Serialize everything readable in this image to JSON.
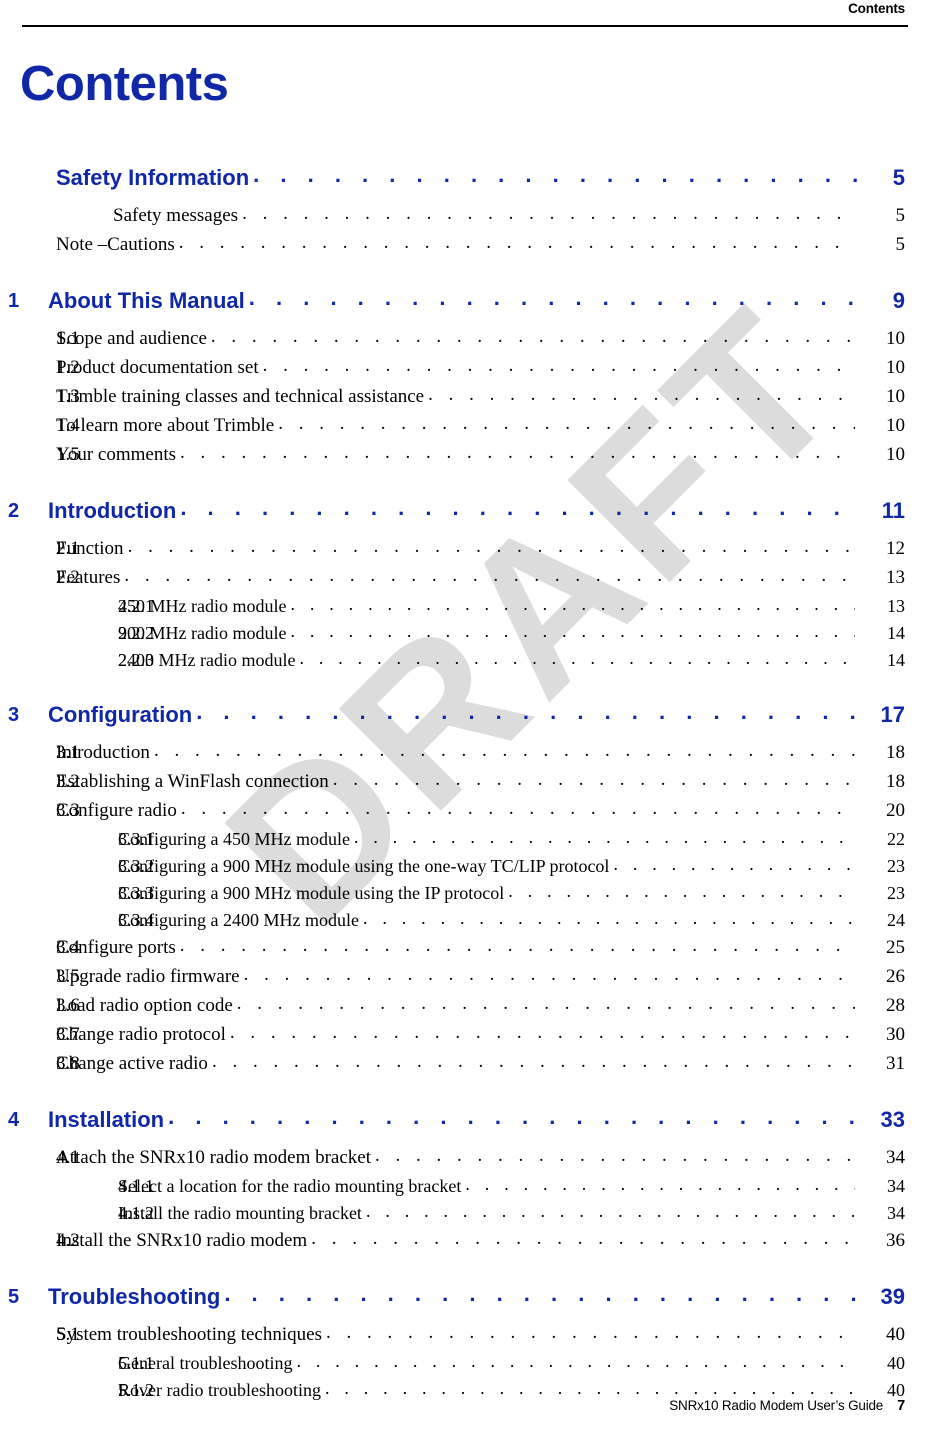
{
  "header": {
    "title": "Contents"
  },
  "page_title": "Contents",
  "watermark": {
    "text": "DRAFT",
    "color": "#dcdcdc"
  },
  "colors": {
    "heading_blue": "#1028A8",
    "body_black": "#000000"
  },
  "leader_dot": ". . . . . . . . . . . . . . . . . . . . . . . . . . . . . . . . . . . . . . . . . . . . . . . . . . . . . . . . . . . . . . . . . . . .",
  "toc": {
    "entries": [
      {
        "level": "chapter",
        "number": "",
        "label": "Safety Information",
        "page": "5"
      },
      {
        "level": "front-sub",
        "number": "",
        "label": "Safety messages",
        "page": "5"
      },
      {
        "level": "front",
        "number": "",
        "label": "Note –Cautions",
        "page": "5"
      },
      {
        "level": "chapter",
        "number": "1",
        "label": "About This Manual",
        "page": "9"
      },
      {
        "level": "section",
        "number": "1.1",
        "label": "Scope and audience",
        "page": "10"
      },
      {
        "level": "section",
        "number": "1.2",
        "label": "Product documentation set",
        "page": "10"
      },
      {
        "level": "section",
        "number": "1.3",
        "label": "Trimble training classes and technical assistance",
        "page": "10"
      },
      {
        "level": "section",
        "number": "1.4",
        "label": "To learn more about Trimble",
        "page": "10"
      },
      {
        "level": "section",
        "number": "1.5",
        "label": "Your comments",
        "page": "10"
      },
      {
        "level": "chapter",
        "number": "2",
        "label": "Introduction",
        "page": "11"
      },
      {
        "level": "section",
        "number": "2.1",
        "label": "Function",
        "page": "12"
      },
      {
        "level": "section",
        "number": "2.2",
        "label": "Features",
        "page": "13"
      },
      {
        "level": "subsection",
        "number": "2.2.1",
        "label": "450 MHz radio module",
        "page": "13"
      },
      {
        "level": "subsection",
        "number": "2.2.2",
        "label": "900 MHz radio module",
        "page": "14"
      },
      {
        "level": "subsection",
        "number": "2.2.3",
        "label": "2400 MHz radio module",
        "page": "14"
      },
      {
        "level": "chapter",
        "number": "3",
        "label": "Configuration",
        "page": "17"
      },
      {
        "level": "section",
        "number": "3.1",
        "label": "Introduction",
        "page": "18"
      },
      {
        "level": "section",
        "number": "3.2",
        "label": "Establishing a WinFlash connection",
        "page": "18"
      },
      {
        "level": "section",
        "number": "3.3",
        "label": "Configure radio",
        "page": "20"
      },
      {
        "level": "subsection",
        "number": "3.3.1",
        "label": "Configuring a 450 MHz module",
        "page": "22"
      },
      {
        "level": "subsection",
        "number": "3.3.2",
        "label": "Configuring a 900 MHz module using the one-way TC/LIP protocol",
        "page": "23"
      },
      {
        "level": "subsection",
        "number": "3.3.3",
        "label": "Configuring a 900 MHz module using the IP protocol",
        "page": "23"
      },
      {
        "level": "subsection",
        "number": "3.3.4",
        "label": "Configuring a 2400 MHz module",
        "page": "24"
      },
      {
        "level": "section",
        "number": "3.4",
        "label": "Configure ports",
        "page": "25"
      },
      {
        "level": "section",
        "number": "3.5",
        "label": "Upgrade radio firmware",
        "page": "26"
      },
      {
        "level": "section",
        "number": "3.6",
        "label": "Load radio option code",
        "page": "28"
      },
      {
        "level": "section",
        "number": "3.7",
        "label": "Change radio protocol",
        "page": "30"
      },
      {
        "level": "section",
        "number": "3.8",
        "label": "Change active radio",
        "page": "31"
      },
      {
        "level": "chapter",
        "number": "4",
        "label": "Installation",
        "page": "33"
      },
      {
        "level": "section",
        "number": "4.1",
        "label": "Attach the SNRx10 radio modem bracket",
        "page": "34"
      },
      {
        "level": "subsection",
        "number": "4.1.1",
        "label": "Select a location for the radio mounting bracket",
        "page": "34"
      },
      {
        "level": "subsection",
        "number": "4.1.2",
        "label": "Install the radio mounting bracket",
        "page": "34"
      },
      {
        "level": "section",
        "number": "4.2",
        "label": "Install the SNRx10 radio modem",
        "page": "36"
      },
      {
        "level": "chapter",
        "number": "5",
        "label": "Troubleshooting",
        "page": "39"
      },
      {
        "level": "section",
        "number": "5.1",
        "label": "System troubleshooting techniques",
        "page": "40"
      },
      {
        "level": "subsection",
        "number": "5.1.1",
        "label": "General troubleshooting",
        "page": "40"
      },
      {
        "level": "subsection",
        "number": "5.1.2",
        "label": "Rover radio troubleshooting",
        "page": "40"
      }
    ]
  },
  "footer": {
    "document_title": "SNRx10 Radio Modem User’s Guide",
    "page_number": "7"
  }
}
